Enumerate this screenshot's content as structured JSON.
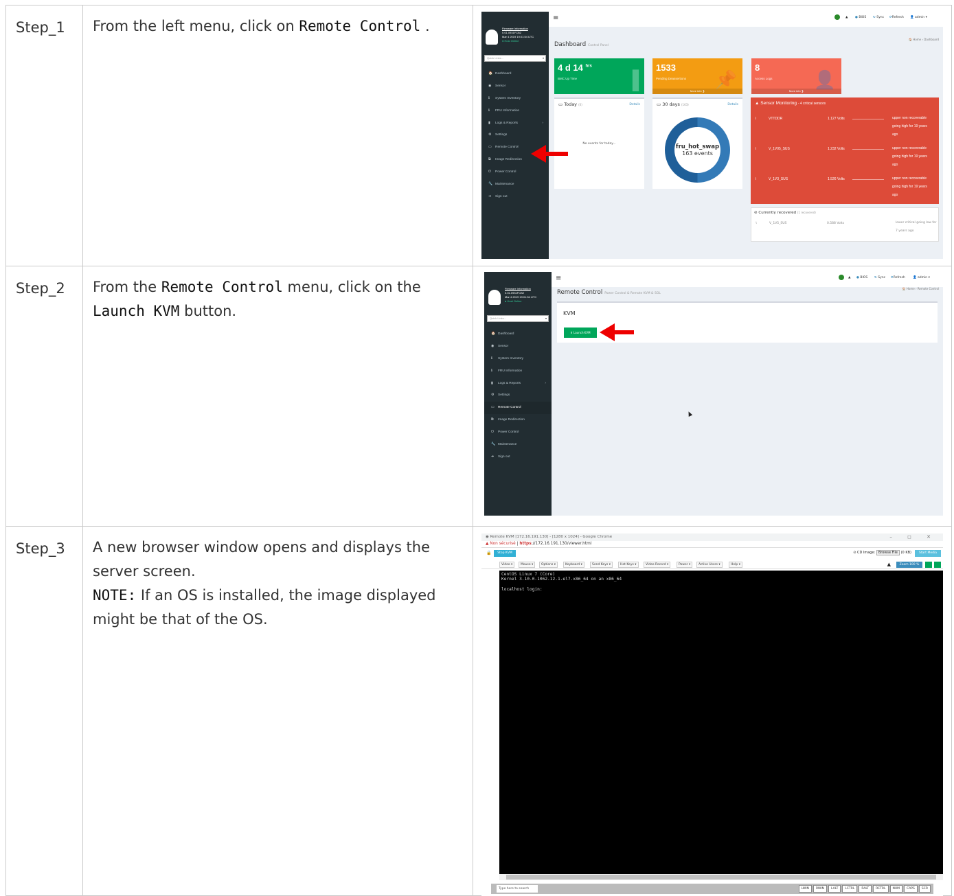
{
  "steps": [
    {
      "label": "Step_1",
      "desc_prefix": "From the left menu, click on ",
      "desc_keyword": "Remote Control",
      "desc_suffix": " ."
    },
    {
      "label": "Step_2",
      "desc_prefix": "From the ",
      "desc_keyword": "Remote Control",
      "desc_mid": " menu, click on the",
      "desc_keyword2": "Launch KVM",
      "desc_suffix": " button."
    },
    {
      "label": "Step_3",
      "desc_line1": "A new browser window opens and displays the server screen.",
      "note_label": "NOTE:",
      "note_text": " If an OS is installed, the image displayed might be that of the OS."
    }
  ],
  "bmc": {
    "user_info": [
      "Firmware Information",
      "0.01.0931FCB2",
      "Mar 4 2019 19:01:54 UTC",
      "● Host Online"
    ],
    "quick_links": "Quick Links...",
    "menu": [
      "Dashboard",
      "Sensor",
      "System Inventory",
      "FRU Information",
      "Logs & Reports",
      "Settings",
      "Remote Control",
      "Image Redirection",
      "Power Control",
      "Maintenance",
      "Sign out"
    ],
    "menu_icons": [
      "🏠",
      "◉",
      "ℹ",
      "ℹ",
      "▮",
      "⚙",
      "▭",
      "⧉",
      "⏻",
      "🔧",
      "➜"
    ],
    "topbar": {
      "bios": "BIOS",
      "sync": "Sync",
      "refresh": "Refresh",
      "admin": "admin"
    }
  },
  "dashboard": {
    "title": "Dashboard",
    "subtitle": "Control Panel",
    "crumb": "🏠 Home  ›  Dashboard",
    "tiles": [
      {
        "value": "4 d 14",
        "unit": "hrs",
        "label": "BMC Up Time",
        "color": "#00a65a"
      },
      {
        "value": "1533",
        "label": "Pending Deassertions",
        "foot": "More info ❯",
        "color": "#f39c12"
      },
      {
        "value": "8",
        "label": "Access Logs",
        "foot": "More info ❯",
        "color": "#f56954"
      }
    ],
    "today": {
      "title": "Today",
      "count": "(0)",
      "details": "Details",
      "empty": "No events for today..."
    },
    "month": {
      "title": "30 days",
      "count": "(163)",
      "details": "Details",
      "donut_name": "fru_hot_swap",
      "donut_count": "163 events"
    },
    "sensor_monitoring": {
      "title": "Sensor Monitoring",
      "critical": "- 4 critical sensors",
      "rows": [
        {
          "name": "VTTDDR",
          "value": "1.127 Volts",
          "status": "upper non recoverable going high for 19 years ago"
        },
        {
          "name": "V_1V05_SUS",
          "value": "1.232 Volts",
          "status": "upper non recoverable going high for 19 years ago"
        },
        {
          "name": "V_1V3_SUS",
          "value": "1.526 Volts",
          "status": "upper non recoverable going high for 19 years ago"
        }
      ]
    },
    "recovered": {
      "title": "Currently recovered",
      "count": "(1 recovered)",
      "name": "V_1V5_SUS",
      "value": "0.588 Volts",
      "status": "lower critical going low for 7 years ago"
    }
  },
  "remote_control": {
    "title": "Remote Control",
    "subtitle": "Power Control & Remote KVM & SOL",
    "crumb": "🏠 Home  ›  Remote Control",
    "kvm_heading": "KVM",
    "launch_button": "⬆ Launch KVM"
  },
  "kvm_viewer": {
    "window_title": "Remote KVM [172.16.191.130] - [1280 x 1024] - Google Chrome",
    "window_controls": "– ◻ ✕",
    "insecure": "▲ Non sécurisé",
    "url_https": "https",
    "url_rest": "://172.16.191.130/viewer.html",
    "stop_kvm": "Stop KVM",
    "cd_image": "CD Image:",
    "browse_file": "Browse File",
    "file_size": "(0 KB)",
    "start_media": "Start Media",
    "menus": [
      "Video ▾",
      "Mouse ▾",
      "Options ▾",
      "Keyboard ▾",
      "Send Keys ▾",
      "Hot Keys ▾",
      "Video Record ▾",
      "Power ▾",
      "Active Users ▾",
      "Help ▾"
    ],
    "zoom": "Zoom 100 %",
    "terminal": "CentOS Linux 7 (Core)\nKernel 3.10.0-1062.12.1.el7.x86_64 on an x86_64\n\nlocalhost login:",
    "search_placeholder": "Type here to search",
    "keys": [
      "LWIN",
      "RWIN",
      "LALT",
      "LCTRL",
      "RALT",
      "RCTRL",
      "NUM",
      "CAPS",
      "SCR"
    ]
  },
  "colors": {
    "arrow": "#e00000",
    "sensor_red": "#dd4b39",
    "green": "#00a65a",
    "sidebar": "#222d32"
  }
}
